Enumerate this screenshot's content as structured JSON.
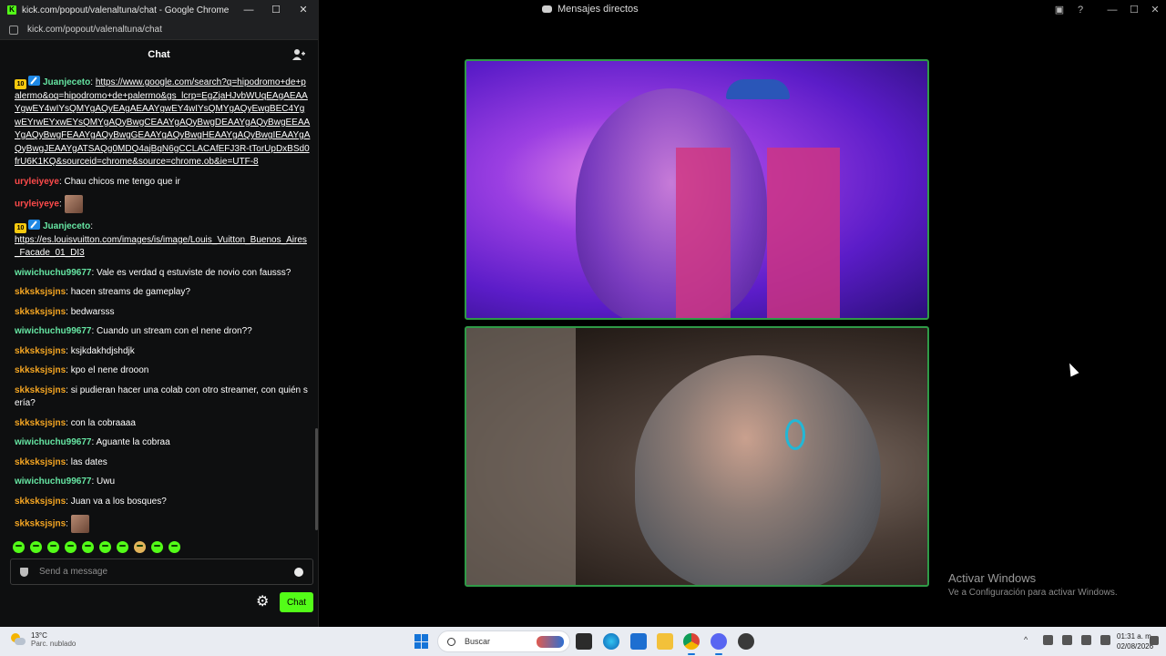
{
  "discord": {
    "title": "Mensajes directos",
    "activation_title": "Activar Windows",
    "activation_sub": "Ve a Configuración para activar Windows."
  },
  "chrome": {
    "window_title": "kick.com/popout/valenaltuna/chat - Google Chrome",
    "url": "kick.com/popout/valenaltuna/chat",
    "minimize": "—",
    "maximize": "☐",
    "close": "✕"
  },
  "chat": {
    "header": "Chat",
    "messages": [
      {
        "user": "Juanjeceto",
        "color": "#66e6a3",
        "badges": true,
        "text": "https://www.google.com/search?q=hipodromo+de+palermo&oq=hipodromo+de+palermo&gs_lcrp=EgZjaHJvbWUqEAgAEAAYgwEY4wIYsQMYgAQyEAgAEAAYgwEY4wIYsQMYgAQyEwgBEC4YgwEYrwEYxwEYsQMYgAQyBwgCEAAYgAQyBwgDEAAYgAQyBwgEEAAYgAQyBwgFEAAYgAQyBwgGEAAYgAQyBwgHEAAYgAQyBwgIEAAYgAQyBwgJEAAYgATSAQg0MDQ4ajBqN6gCCLACAfEFJ3R-tTorUpDxBSd0frU6K1KQ&sourceid=chrome&source=chrome.ob&ie=UTF-8",
        "link": true
      },
      {
        "user": "uryleiyeye",
        "color": "#ff4b4b",
        "text": "Chau chicos me tengo que ir"
      },
      {
        "user": "uryleiyeye",
        "color": "#ff4b4b",
        "text": "",
        "emote": true
      },
      {
        "user": "Juanjeceto",
        "color": "#66e6a3",
        "badges": true,
        "text": "https://es.louisvuitton.com/images/is/image/Louis_Vuitton_Buenos_Aires_Facade_01_DI3",
        "link": true,
        "break": true
      },
      {
        "user": "wiwichuchu99677",
        "color": "#66e6a3",
        "text": "Vale es verdad q estuviste de novio con fausss?"
      },
      {
        "user": "skksksjsjns",
        "color": "#f5a623",
        "text": "hacen streams de gameplay?"
      },
      {
        "user": "skksksjsjns",
        "color": "#f5a623",
        "text": "bedwarsss"
      },
      {
        "user": "wiwichuchu99677",
        "color": "#66e6a3",
        "text": "Cuando un stream con el nene dron??"
      },
      {
        "user": "skksksjsjns",
        "color": "#f5a623",
        "text": "ksjkdakhdjshdjk"
      },
      {
        "user": "skksksjsjns",
        "color": "#f5a623",
        "text": "kpo el nene drooon"
      },
      {
        "user": "skksksjsjns",
        "color": "#f5a623",
        "text": "si pudieran hacer una colab con otro streamer, con quién sería?"
      },
      {
        "user": "skksksjsjns",
        "color": "#f5a623",
        "text": "con la cobraaaa"
      },
      {
        "user": "wiwichuchu99677",
        "color": "#66e6a3",
        "text": "Aguante la cobraa"
      },
      {
        "user": "skksksjsjns",
        "color": "#f5a623",
        "text": "las dates"
      },
      {
        "user": "wiwichuchu99677",
        "color": "#66e6a3",
        "text": "Uwu"
      },
      {
        "user": "skksksjsjns",
        "color": "#f5a623",
        "text": "Juan va a los bosques?"
      },
      {
        "user": "skksksjsjns",
        "color": "#f5a623",
        "text": "",
        "emote": true
      }
    ],
    "badge_level": "10",
    "input_placeholder": "Send a message",
    "send_button": "Chat",
    "accent": "#53fc18"
  },
  "taskbar": {
    "temperature": "13°C",
    "weather": "Parc. nublado",
    "search_placeholder": "Buscar",
    "time": "01:31 a. m.",
    "date": "02/08/2026"
  }
}
